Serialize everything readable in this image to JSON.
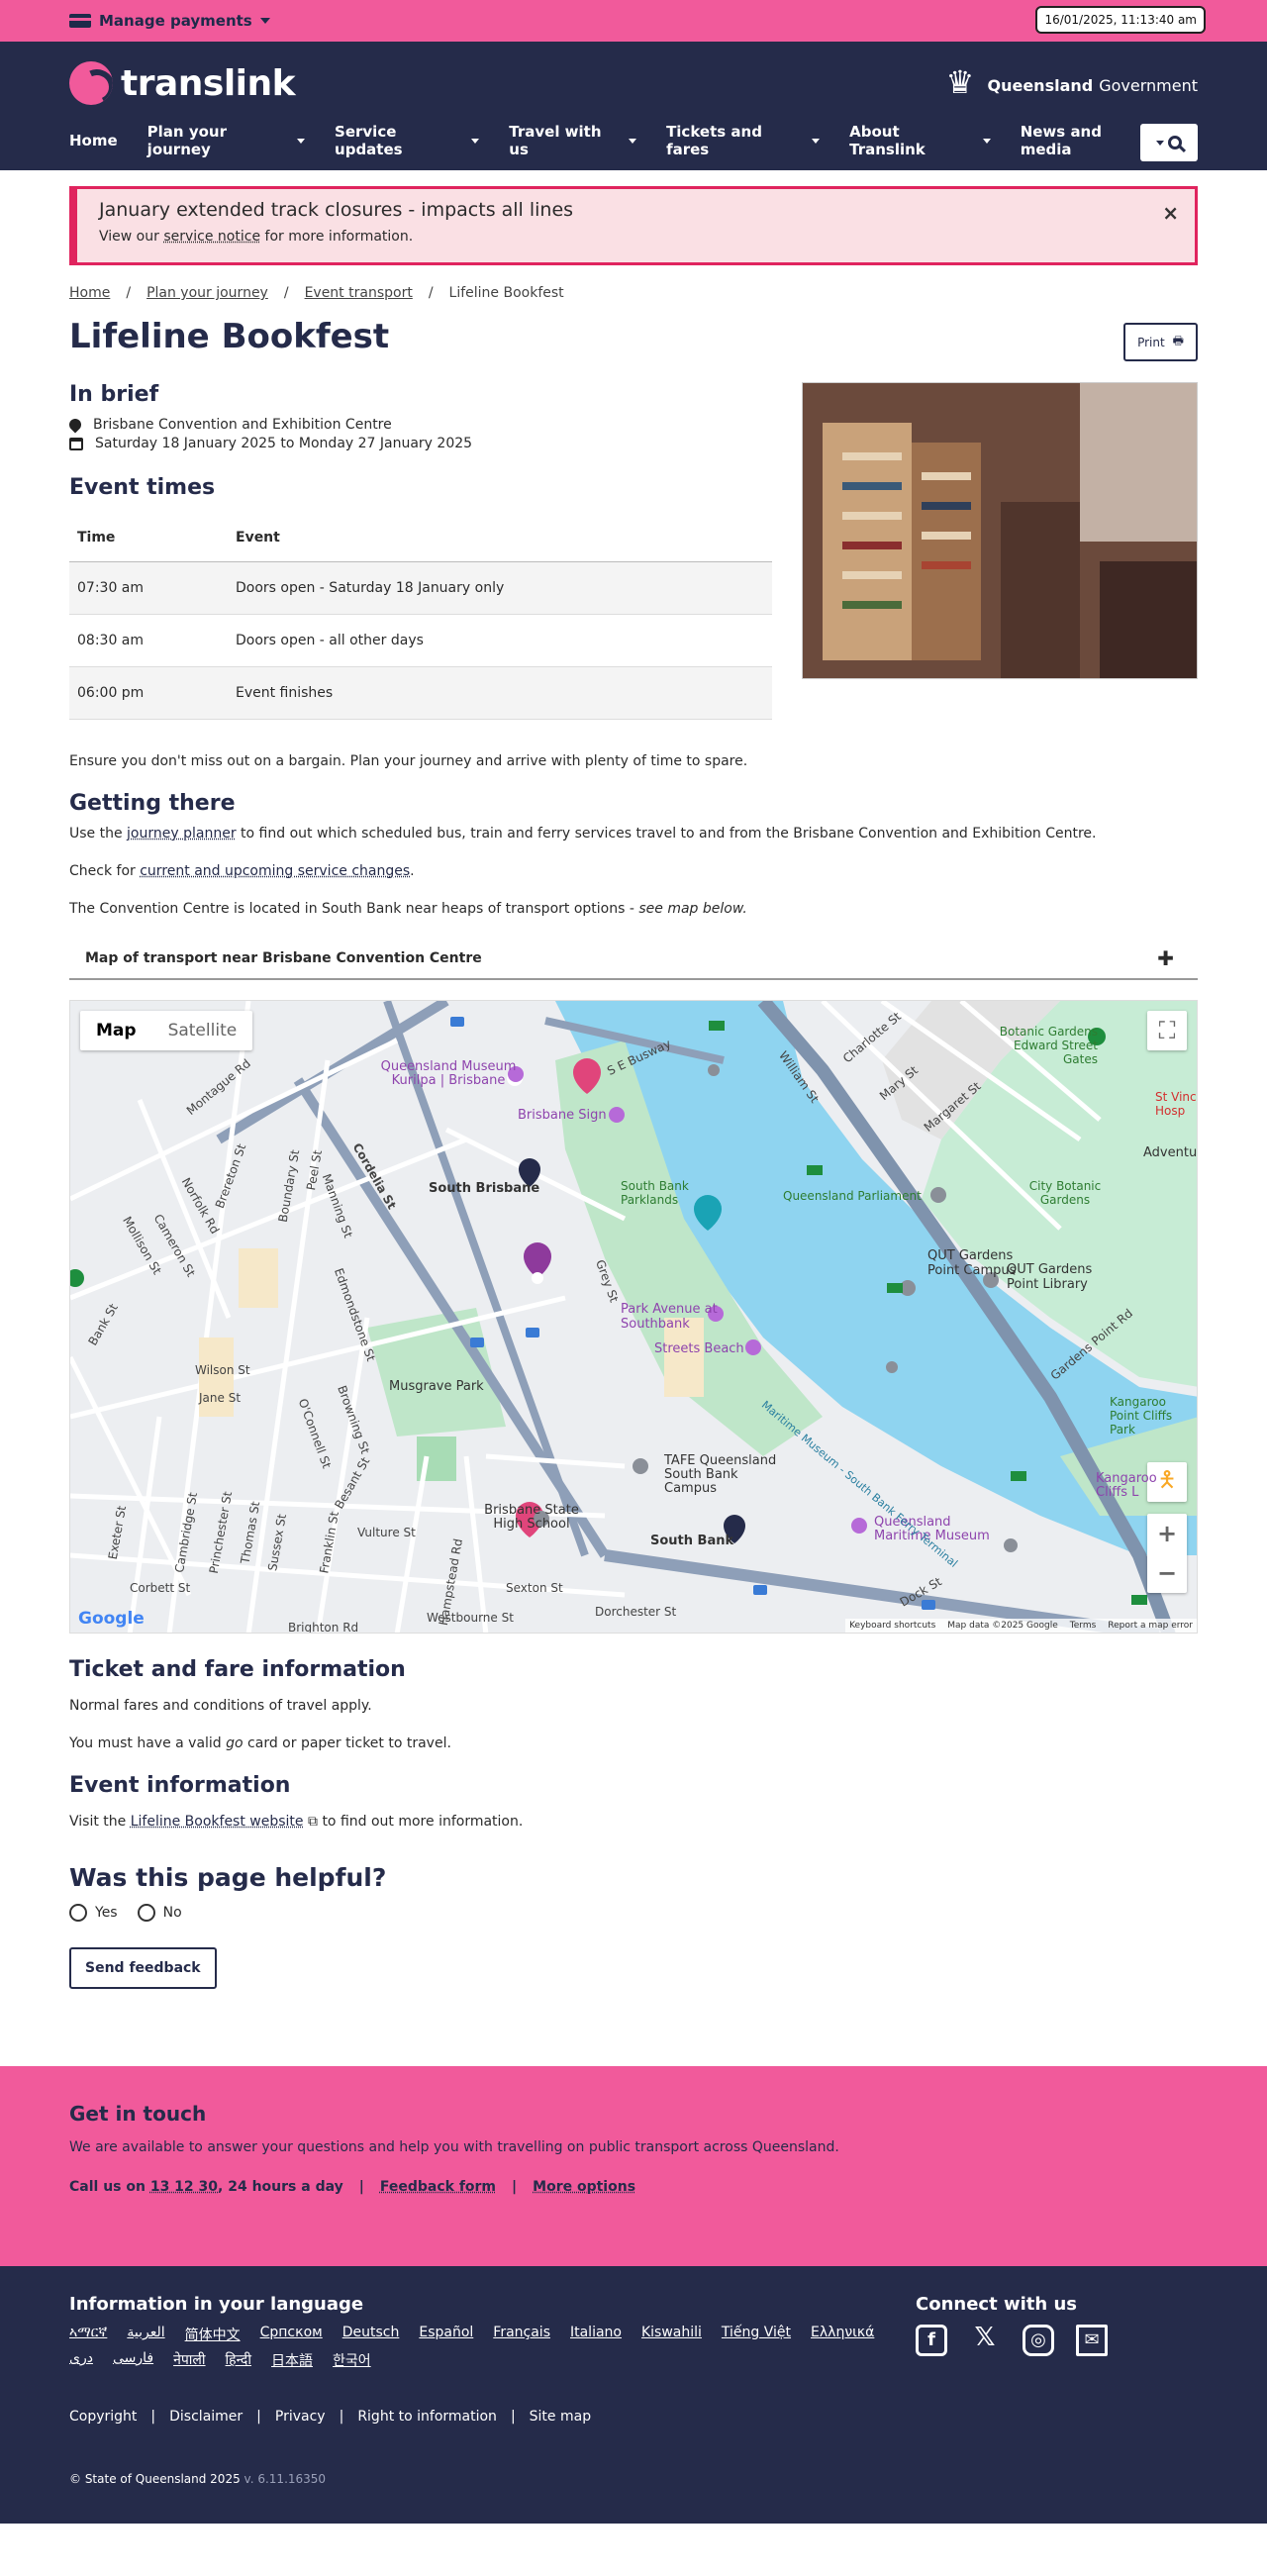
{
  "topbar": {
    "manage_label": "Manage payments",
    "datetime": "16/01/2025, 11:13:40 am"
  },
  "header": {
    "logo_text": "translink",
    "gov_bold": "Queensland",
    "gov_text": "Government",
    "nav": [
      "Home",
      "Plan your journey",
      "Service updates",
      "Travel with us",
      "Tickets and fares",
      "About Translink",
      "News and media"
    ]
  },
  "alert": {
    "title": "January extended track closures - impacts all lines",
    "text_prefix": "View our",
    "link": "service notice",
    "text_suffix": "for more information."
  },
  "breadcrumb": [
    "Home",
    "Plan your journey",
    "Event transport",
    "Lifeline Bookfest"
  ],
  "page": {
    "title": "Lifeline Bookfest",
    "print_label": "Print",
    "brief_heading": "In brief",
    "location": "Brisbane Convention and Exhibition Centre",
    "dates": "Saturday 18 January 2025 to Monday 27 January 2025",
    "times_heading": "Event times",
    "table_headers": [
      "Time",
      "Event"
    ],
    "rows": [
      {
        "time": "07:30 am",
        "event": "Doors open - Saturday 18 January only"
      },
      {
        "time": "08:30 am",
        "event": "Doors open - all other days"
      },
      {
        "time": "06:00 pm",
        "event": "Event finishes"
      }
    ],
    "intro": "Ensure you don't miss out on a bargain. Plan your journey and arrive with plenty of time to spare.",
    "getting_heading": "Getting there",
    "p1_prefix": "Use the",
    "p1_link": "journey planner",
    "p1_suffix": "to find out which scheduled bus, train and ferry services travel to and from the Brisbane Convention and Exhibition Centre.",
    "p2_prefix": "Check for",
    "p2_link": "current and upcoming service changes",
    "p2_suffix": ".",
    "p3": "The Convention Centre is located in South Bank near heaps of transport options -",
    "p3_em": "see map below.",
    "accordion": "Map of transport near Brisbane Convention Centre",
    "ticket_heading": "Ticket and fare information",
    "ticket_p1": "Normal fares and conditions of travel apply.",
    "ticket_p2_prefix": "You must have a valid",
    "ticket_p2_em": "go",
    "ticket_p2_suffix": "card or paper ticket to travel.",
    "event_heading": "Event information",
    "event_prefix": "Visit the",
    "event_link": "Lifeline Bookfest website",
    "event_suffix": "to find out more information.",
    "helpful_heading": "Was this page helpful?",
    "yes": "Yes",
    "no": "No",
    "feedback_button": "Send feedback"
  },
  "map": {
    "toggle_map": "Map",
    "toggle_satellite": "Satellite",
    "labels": {
      "museum": "Queensland Museum Kurilpa | Brisbane",
      "brisbane_sign": "Brisbane Sign",
      "south_brisbane": "South Brisbane",
      "south_bank_parklands": "South Bank Parklands",
      "qld_parliament": "Queensland Parliament",
      "botanic_gardens": "Botanic Gardens Edward Street Gates",
      "city_botanic": "City Botanic Gardens",
      "qut_campus": "QUT Gardens Point Campus",
      "qut_library": "QUT Gardens Point Library",
      "park_avenue": "Park Avenue at Southbank",
      "streets_beach": "Streets Beach",
      "musgrave": "Musgrave Park",
      "tafe": "TAFE Queensland South Bank Campus",
      "high_school": "Brisbane State High School",
      "south_bank": "South Bank",
      "maritime": "Queensland Maritime Museum",
      "kangaroo_point": "Kangaroo Point Cliffs Park",
      "kangaroo_cliffs": "Kangaroo Cliffs L",
      "adventure": "Adventu",
      "st_vinc": "St Vinc Hosp",
      "river": "Maritime Museum - South Bank Ferry Terminal",
      "streets": [
        "S E Busway",
        "William St",
        "Charlotte St",
        "Mary St",
        "Margaret St",
        "Montague Rd",
        "Cordelia St",
        "Peel St",
        "Boundary St",
        "Brereton St",
        "Norfolk Rd",
        "Cameron St",
        "Edmondstone St",
        "Grey St",
        "Vulture St",
        "Dorchester St",
        "Sexton St",
        "Westbourne St",
        "Brighton Rd",
        "Hampstead Rd",
        "Franklin St",
        "Sussex St",
        "Thomas St",
        "Princhester St",
        "Cambridge St",
        "Exeter St",
        "Corbett St",
        "Jane St",
        "Wilson St",
        "O'Connell St",
        "Besant St",
        "Browning St",
        "Manning St",
        "Bank St",
        "Mollison St",
        "Dock St",
        "Gardens Point Rd"
      ]
    },
    "footer": [
      "Keyboard shortcuts",
      "Map data ©2025 Google",
      "Terms",
      "Report a map error"
    ],
    "google": "Google"
  },
  "get_in_touch": {
    "heading": "Get in touch",
    "text": "We are available to answer your questions and help you with travelling on public transport across Queensland.",
    "call_prefix": "Call us on",
    "phone": "13 12 30",
    "call_suffix": ", 24 hours a day",
    "feedback": "Feedback form",
    "more": "More options"
  },
  "footer": {
    "lang_heading": "Information in your language",
    "languages": [
      "ኣማርኛ",
      "العربية",
      "简体中文",
      "Српском",
      "Deutsch",
      "Español",
      "Français",
      "Italiano",
      "Kiswahili",
      "Tiếng Việt",
      "Ελληνικά",
      "دری",
      "فارسی",
      "नेपाली",
      "हिन्दी",
      "日本語",
      "한국어"
    ],
    "connect_heading": "Connect with us",
    "links": [
      "Copyright",
      "Disclaimer",
      "Privacy",
      "Right to information",
      "Site map"
    ],
    "copyright": "© State of Queensland 2025",
    "version": "v. 6.11.16350"
  },
  "colors": {
    "pink": "#f15a9b",
    "navy": "#252b4a",
    "alert_red": "#e0245e"
  }
}
